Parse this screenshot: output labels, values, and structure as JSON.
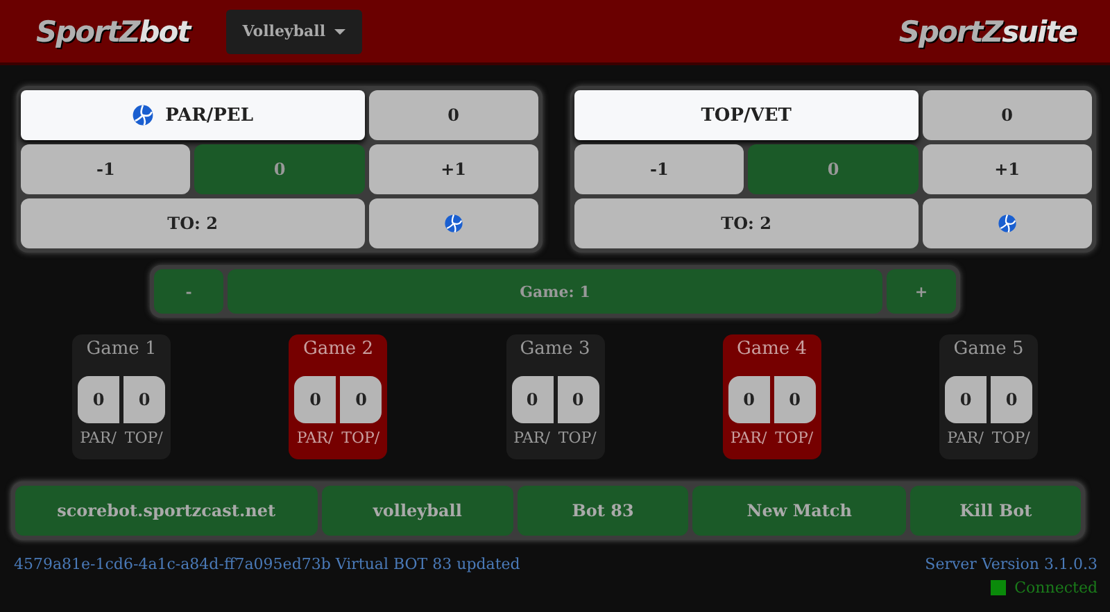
{
  "header": {
    "logo": {
      "first": "SportZ",
      "second": "bot"
    },
    "sport_dropdown": "Volleyball",
    "suite_logo": {
      "first": "SportZ",
      "second": "suite"
    }
  },
  "teams": [
    {
      "name": "PAR/PEL",
      "serving": true,
      "score": "0",
      "minus": "-1",
      "sets": "0",
      "plus": "+1",
      "timeouts": "TO: 2"
    },
    {
      "name": "TOP/VET",
      "serving": false,
      "score": "0",
      "minus": "-1",
      "sets": "0",
      "plus": "+1",
      "timeouts": "TO: 2"
    }
  ],
  "game_bar": {
    "minus": "-",
    "label": "Game: 1",
    "plus": "+"
  },
  "games": [
    {
      "title": "Game 1",
      "highlighted": false,
      "scores": [
        "0",
        "0"
      ],
      "teams": [
        "PAR/",
        "TOP/"
      ]
    },
    {
      "title": "Game 2",
      "highlighted": true,
      "scores": [
        "0",
        "0"
      ],
      "teams": [
        "PAR/",
        "TOP/"
      ]
    },
    {
      "title": "Game 3",
      "highlighted": false,
      "scores": [
        "0",
        "0"
      ],
      "teams": [
        "PAR/",
        "TOP/"
      ]
    },
    {
      "title": "Game 4",
      "highlighted": true,
      "scores": [
        "0",
        "0"
      ],
      "teams": [
        "PAR/",
        "TOP/"
      ]
    },
    {
      "title": "Game 5",
      "highlighted": false,
      "scores": [
        "0",
        "0"
      ],
      "teams": [
        "PAR/",
        "TOP/"
      ]
    }
  ],
  "actions": [
    "scorebot.sportzcast.net",
    "volleyball",
    "Bot 83",
    "New Match",
    "Kill Bot"
  ],
  "status": {
    "message": "4579a81e-1cd6-4a1c-a84d-ff7a095ed73b Virtual BOT 83 updated",
    "server_version": "Server Version 3.1.0.3",
    "connection": "Connected",
    "connected": true
  }
}
